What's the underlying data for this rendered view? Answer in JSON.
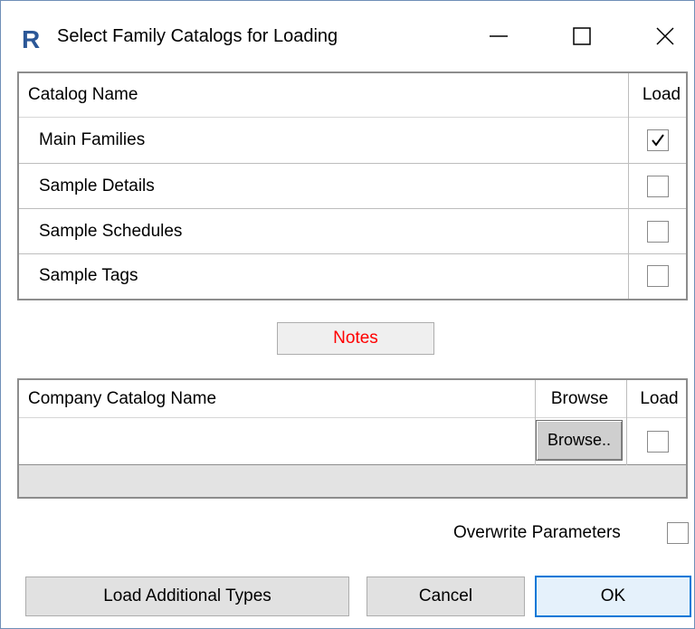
{
  "window": {
    "title": "Select Family Catalogs for Loading",
    "app_icon": "revit-r-icon",
    "controls": [
      "minimize-icon",
      "maximize-icon",
      "close-icon"
    ]
  },
  "catalog_table": {
    "headers": {
      "name": "Catalog Name",
      "load": "Load"
    },
    "rows": [
      {
        "name": "Main Families",
        "load": true
      },
      {
        "name": "Sample Details",
        "load": false
      },
      {
        "name": "Sample Schedules",
        "load": false
      },
      {
        "name": "Sample Tags",
        "load": false
      }
    ]
  },
  "notes_button": {
    "label": "Notes",
    "color": "#ff0000"
  },
  "company_table": {
    "headers": {
      "name": "Company Catalog Name",
      "browse": "Browse",
      "load": "Load"
    },
    "row": {
      "name": "",
      "browse_label": "Browse..",
      "load": false
    }
  },
  "overwrite": {
    "label": "Overwrite Parameters",
    "checked": false
  },
  "buttons": {
    "load_additional": "Load Additional Types",
    "cancel": "Cancel",
    "ok": "OK"
  },
  "colors": {
    "ok_border": "#0078d7",
    "revit_blue": "#2b5797"
  }
}
